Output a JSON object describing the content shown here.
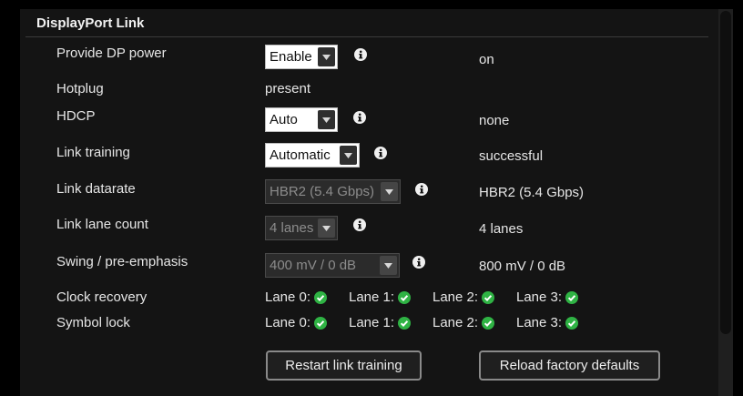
{
  "section": {
    "title": "DisplayPort Link"
  },
  "rows": {
    "dp_power": {
      "label": "Provide DP power",
      "select": "Enable",
      "status": "on"
    },
    "hotplug": {
      "label": "Hotplug",
      "value": "present"
    },
    "hdcp": {
      "label": "HDCP",
      "select": "Auto",
      "status": "none"
    },
    "link_training": {
      "label": "Link training",
      "select": "Automatic",
      "status": "successful"
    },
    "link_datarate": {
      "label": "Link datarate",
      "select": "HBR2 (5.4 Gbps)",
      "status": "HBR2 (5.4 Gbps)"
    },
    "link_lane_count": {
      "label": "Link lane count",
      "select": "4 lanes",
      "status": "4 lanes"
    },
    "swing": {
      "label": "Swing / pre-emphasis",
      "select": "400 mV / 0 dB",
      "status": "800 mV / 0 dB"
    },
    "clock_recovery": {
      "label": "Clock recovery",
      "lanes": [
        "Lane 0:",
        "Lane 1:",
        "Lane 2:",
        "Lane 3:"
      ]
    },
    "symbol_lock": {
      "label": "Symbol lock",
      "lanes": [
        "Lane 0:",
        "Lane 1:",
        "Lane 2:",
        "Lane 3:"
      ]
    }
  },
  "buttons": {
    "restart": "Restart link training",
    "reload": "Reload factory defaults"
  },
  "icons": {
    "info": "info-icon",
    "check": "check-circle-icon",
    "caret": "chevron-down-icon"
  },
  "colors": {
    "check": "#2fb344",
    "background": "#141414"
  }
}
